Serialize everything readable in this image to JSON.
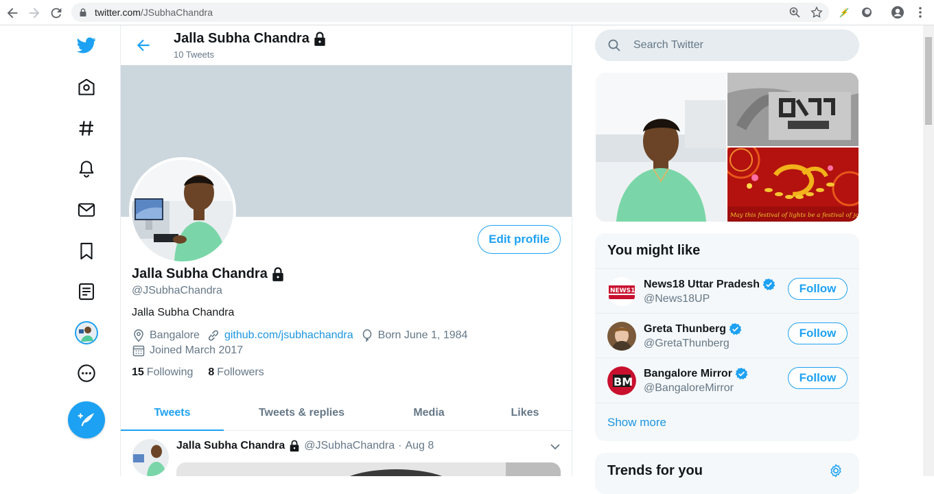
{
  "browser": {
    "url_host": "twitter.com",
    "url_path": "/JSubhaChandra"
  },
  "header": {
    "title": "Jalla Subha Chandra",
    "tweet_count": "10 Tweets"
  },
  "profile": {
    "name": "Jalla Subha Chandra",
    "handle": "@JSubhaChandra",
    "bio": "Jalla Subha Chandra",
    "location": "Bangalore",
    "link": "github.com/jsubhachandra",
    "birthday": "Born June 1, 1984",
    "joined": "Joined March 2017",
    "following_count": "15",
    "following_label": "Following",
    "followers_count": "8",
    "followers_label": "Followers",
    "edit_label": "Edit profile"
  },
  "tabs": [
    {
      "label": "Tweets"
    },
    {
      "label": "Tweets & replies"
    },
    {
      "label": "Media"
    },
    {
      "label": "Likes"
    }
  ],
  "tweet": {
    "name": "Jalla Subha Chandra",
    "handle": "@JSubhaChandra",
    "sep": "·",
    "date": "Aug 8"
  },
  "search": {
    "placeholder": "Search Twitter"
  },
  "media_caption": "May this festival of lights be a festival of joy for you",
  "who_to_follow": {
    "title": "You might like",
    "items": [
      {
        "name": "News18 Uttar Pradesh",
        "handle": "@News18UP",
        "button": "Follow"
      },
      {
        "name": "Greta Thunberg",
        "handle": "@GretaThunberg",
        "button": "Follow"
      },
      {
        "name": "Bangalore Mirror",
        "handle": "@BangaloreMirror",
        "button": "Follow"
      }
    ],
    "show_more": "Show more"
  },
  "trends": {
    "title": "Trends for you"
  },
  "colors": {
    "accent": "#1da1f2",
    "banner": "#ccd6dd",
    "secondary_text": "#657786"
  }
}
